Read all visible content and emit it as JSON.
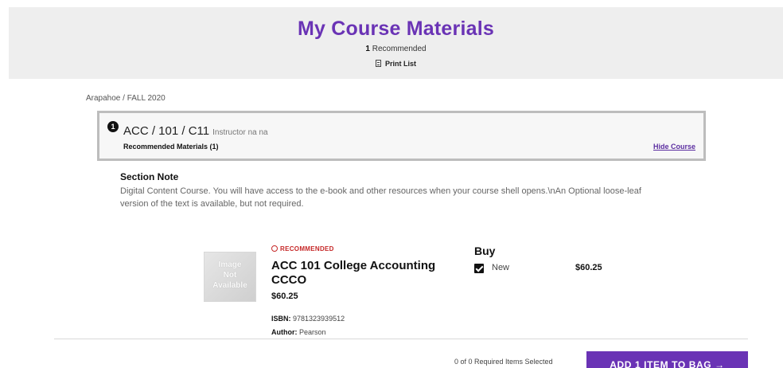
{
  "header": {
    "title": "My Course Materials",
    "recommended_count": "1",
    "recommended_label": "Recommended",
    "print_label": "Print List",
    "print_icon": "print-list-icon"
  },
  "breadcrumb": "Arapahoe / FALL 2020",
  "course": {
    "number": "1",
    "code": "ACC / 101 / C11",
    "instructor": "Instructor na na",
    "materials_label": "Recommended Materials (1)",
    "hide_label": "Hide Course"
  },
  "section_note": {
    "title": "Section Note",
    "text": "Digital Content Course. You will have access to the e-book and other resources when your course shell opens.\\nAn Optional loose-leaf version of the text is available, but not required."
  },
  "product": {
    "image_text": [
      "Image",
      "Not",
      "Available"
    ],
    "badge": "RECOMMENDED",
    "badge_icon": "recommended-icon",
    "title": "ACC 101 College Accounting CCCO",
    "price": "$60.25",
    "isbn_label": "ISBN:",
    "isbn": "9781323939512",
    "author_label": "Author:",
    "author": "Pearson"
  },
  "buy": {
    "heading": "Buy",
    "option_label": "New",
    "option_price": "$60.25",
    "option_checked": true
  },
  "footer": {
    "selected_text": "0 of 0 Required Items Selected",
    "add_button_label": "ADD 1 ITEM TO BAG →"
  },
  "colors": {
    "accent": "#6a33b5",
    "badge": "#c62828",
    "header_bg": "#eeeeee"
  }
}
